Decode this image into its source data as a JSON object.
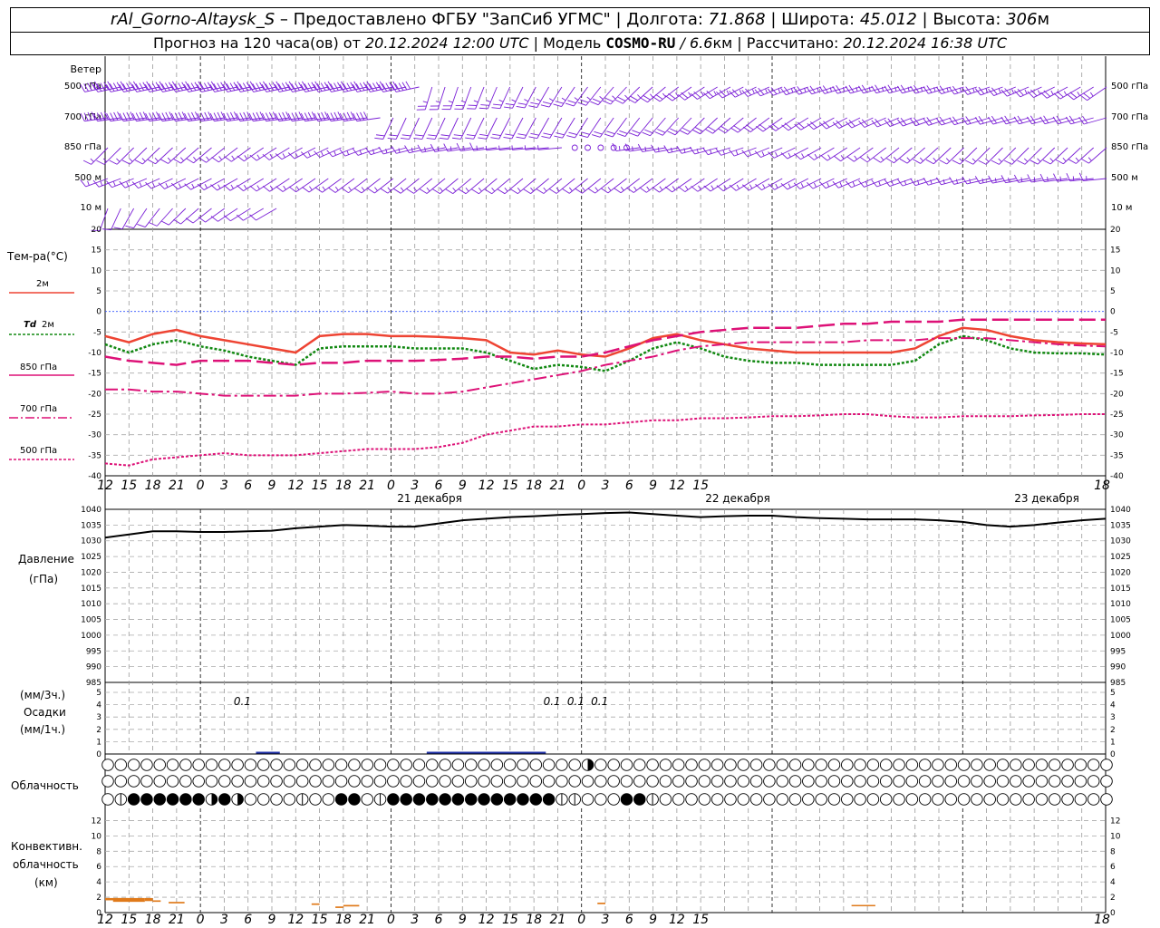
{
  "header": {
    "station": "rAl_Gorno-Altaysk_S",
    "provider": " – Предоставлено ФГБУ \"ЗапСиб УГМС\" | Долгота: ",
    "lon": "71.868",
    "lat_label": " | Широта: ",
    "lat": "45.012",
    "alt_label": " | Высота: ",
    "alt": "306",
    "alt_unit": "м",
    "forecast_prefix": "Прогноз на 120 часа(ов) от ",
    "forecast_time": "20.12.2024 12:00 UTC",
    "model_prefix": " | Модель ",
    "model": "COSMO-RU",
    "model_res": " / 6.6",
    "model_res_unit": "км",
    "calc_prefix": " | Рассчитано: ",
    "calc_time": "20.12.2024 16:38 UTC"
  },
  "labels": {
    "wind": "Ветер",
    "wind_levels": [
      "500 гПа",
      "700 гПа",
      "850 гПа",
      "500 м",
      "10 м"
    ],
    "temp_title": "Тем-ра(°C)",
    "temp_2m": "2м",
    "td": "Td",
    "td_2m": "2м",
    "t850": "850 гПа",
    "t700": "700 гПа",
    "t500": "500 гПа",
    "pressure": "Давление",
    "pressure_unit": "(гПа)",
    "precip_unit3": "(мм/3ч.)",
    "precip": "Осадки",
    "precip_unit1": "(мм/1ч.)",
    "cloud": "Облачность",
    "conv1": "Конвективн.",
    "conv2": "облачность",
    "conv3": "(км)",
    "days": [
      "21 декабря",
      "22 декабря",
      "23 декабря"
    ],
    "hour_ticks": [
      "12",
      "15",
      "18",
      "21",
      "0",
      "3",
      "6",
      "9",
      "12",
      "15",
      "18",
      "21",
      "0",
      "3",
      "6",
      "9",
      "12",
      "15",
      "18",
      "21",
      "0",
      "3",
      "6",
      "9",
      "12",
      "15",
      "18"
    ]
  },
  "colors": {
    "wind": "#7a1fd6",
    "t2m": "#ee4433",
    "td": "#118811",
    "t850": "#dd1177",
    "t700": "#dd1177",
    "t500": "#dd1177",
    "pressure": "#000000",
    "precip": "#2233aa",
    "conv": "#e07a1a",
    "zero_line": "#3355ff"
  },
  "chart_data": [
    {
      "type": "line",
      "title": "Тем-ра(°C)",
      "x_hours_from_start": [
        0,
        3,
        6,
        9,
        12,
        15,
        18,
        21,
        24,
        27,
        30,
        33,
        36,
        39,
        42,
        45,
        48,
        51,
        54,
        57,
        60,
        63,
        66,
        69,
        72,
        75,
        78,
        81,
        84,
        87,
        90,
        93,
        96,
        99,
        102,
        105,
        108,
        111,
        114,
        117,
        120,
        123,
        126
      ],
      "ylim": [
        -40,
        20
      ],
      "series": [
        {
          "name": "2м",
          "values": [
            -6,
            -7.5,
            -5.5,
            -4.5,
            -6,
            -7,
            -8,
            -9,
            -10,
            -6,
            -5.5,
            -5.5,
            -6,
            -6,
            -6.2,
            -6.5,
            -7,
            -10,
            -10.5,
            -9.5,
            -10.5,
            -11,
            -9,
            -6.5,
            -5.5,
            -7,
            -8,
            -9,
            -9.5,
            -10,
            -10,
            -10,
            -10,
            -10,
            -9,
            -6,
            -4,
            -4.5,
            -6,
            -7,
            -7.5,
            -7.8,
            -8
          ]
        },
        {
          "name": "Td 2м",
          "values": [
            -8,
            -10,
            -8,
            -7,
            -8.5,
            -9.5,
            -11,
            -12,
            -13,
            -9,
            -8.5,
            -8.5,
            -8.5,
            -9,
            -9,
            -9,
            -10,
            -12,
            -14,
            -13,
            -13.5,
            -14.5,
            -12,
            -9,
            -7.5,
            -9,
            -11,
            -12,
            -12.5,
            -12.5,
            -13,
            -13,
            -13,
            -13,
            -12,
            -8,
            -6,
            -7,
            -9,
            -10,
            -10.2,
            -10.2,
            -10.5
          ]
        },
        {
          "name": "850 гПа",
          "values": [
            -11,
            -12,
            -12.5,
            -13,
            -12,
            -12,
            -12,
            -12.5,
            -13,
            -12.5,
            -12.5,
            -12,
            -12,
            -12,
            -11.8,
            -11.5,
            -11,
            -11,
            -11.5,
            -11,
            -11,
            -10,
            -8.5,
            -7,
            -6,
            -5,
            -4.5,
            -4,
            -4,
            -4,
            -3.5,
            -3,
            -3,
            -2.5,
            -2.5,
            -2.5,
            -2,
            -2,
            -2,
            -2,
            -2,
            -2,
            -2
          ]
        },
        {
          "name": "700 гПа",
          "values": [
            -19,
            -19,
            -19.5,
            -19.5,
            -20,
            -20.5,
            -20.5,
            -20.5,
            -20.5,
            -20,
            -20,
            -19.8,
            -19.5,
            -20,
            -20,
            -19.5,
            -18.5,
            -17.5,
            -16.5,
            -15.5,
            -14.5,
            -13,
            -12,
            -11,
            -9.5,
            -8.5,
            -8,
            -7.5,
            -7.5,
            -7.5,
            -7.5,
            -7.5,
            -7,
            -7,
            -7,
            -6.5,
            -6.5,
            -6.5,
            -7,
            -7.5,
            -8,
            -8.3,
            -8.5
          ]
        },
        {
          "name": "500 гПа",
          "values": [
            -37,
            -37.5,
            -36,
            -35.5,
            -35,
            -34.5,
            -35,
            -35,
            -35,
            -34.5,
            -34,
            -33.5,
            -33.5,
            -33.5,
            -33,
            -32,
            -30,
            -29,
            -28,
            -28,
            -27.5,
            -27.5,
            -27,
            -26.5,
            -26.5,
            -26,
            -26,
            -25.8,
            -25.5,
            -25.5,
            -25.3,
            -25,
            -25,
            -25.5,
            -25.8,
            -25.8,
            -25.5,
            -25.5,
            -25.5,
            -25.3,
            -25.2,
            -25,
            -25
          ]
        }
      ]
    },
    {
      "type": "line",
      "title": "Давление",
      "x_hours_from_start": [
        0,
        3,
        6,
        9,
        12,
        15,
        18,
        21,
        24,
        27,
        30,
        33,
        36,
        39,
        42,
        45,
        48,
        51,
        54,
        57,
        60,
        63,
        66,
        69,
        72,
        75,
        78,
        81,
        84,
        87,
        90,
        93,
        96,
        99,
        102,
        105,
        108,
        111,
        114,
        117,
        120,
        123,
        126
      ],
      "ylim": [
        985,
        1040
      ],
      "series": [
        {
          "name": "Давление",
          "values": [
            1031,
            1032,
            1033,
            1033,
            1032.8,
            1032.8,
            1033,
            1033.2,
            1034,
            1034.5,
            1035,
            1034.8,
            1034.5,
            1034.5,
            1035.5,
            1036.5,
            1037,
            1037.5,
            1037.8,
            1038.2,
            1038.5,
            1038.8,
            1039,
            1038.5,
            1038,
            1037.5,
            1037.8,
            1038,
            1038,
            1037.5,
            1037.2,
            1037,
            1036.8,
            1036.8,
            1036.8,
            1036.5,
            1036,
            1035,
            1034.5,
            1035,
            1035.8,
            1036.5,
            1037
          ]
        }
      ]
    },
    {
      "type": "bar",
      "title": "Осадки",
      "ylim": [
        0,
        5
      ],
      "categories_hours": [
        15,
        54,
        57,
        60
      ],
      "values": [
        0.1,
        0.1,
        0.1,
        0.1
      ],
      "labels": [
        "0.1",
        "0.1",
        "0.1",
        "0.1"
      ]
    },
    {
      "type": "bar",
      "title": "Конвективн. облачность (км)",
      "ylim": [
        0,
        13
      ],
      "segments": [
        {
          "from": 0,
          "to": 3,
          "base": 1.6,
          "top": 1.9
        },
        {
          "from": 1,
          "to": 5,
          "base": 1.4,
          "top": 1.9
        },
        {
          "from": 5,
          "to": 6,
          "base": 1.5,
          "top": 1.9
        },
        {
          "from": 6,
          "to": 7,
          "base": 1.4,
          "top": 1.6
        },
        {
          "from": 8,
          "to": 10,
          "base": 1.2,
          "top": 1.4
        },
        {
          "from": 26,
          "to": 27,
          "base": 1.0,
          "top": 1.2
        },
        {
          "from": 29,
          "to": 30,
          "base": 0.6,
          "top": 0.8
        },
        {
          "from": 30,
          "to": 32,
          "base": 0.8,
          "top": 1.0
        },
        {
          "from": 62,
          "to": 63,
          "base": 1.1,
          "top": 1.3
        },
        {
          "from": 94,
          "to": 97,
          "base": 0.9,
          "top": 1.0
        }
      ]
    }
  ],
  "wind_svg": "",
  "cloud_rows": {
    "row3": "0,1,3,3,3,3,3,3,2,3,2,0,0,0,0,1,0,0,3,3,0,1,3,3,3,3,3,3,3,3,3,3,3,3,3,1,1,0,0,0,3,3,1,0,0,0,0,0,0,0,0,0,0,0,0,0,0,0,0,0,0,0,0,0,0,0,0,0,0,0,0,0,0,0,0,0,0,0,0,0,0,0,0,0,0,0,0,0,0,0,0,0,0,0,0,0,0,0,0,0,0,0,0,0,0,0,0,0,0,0,0,0,0,0,0,0,0,0",
    "row1_half_index": 37
  }
}
